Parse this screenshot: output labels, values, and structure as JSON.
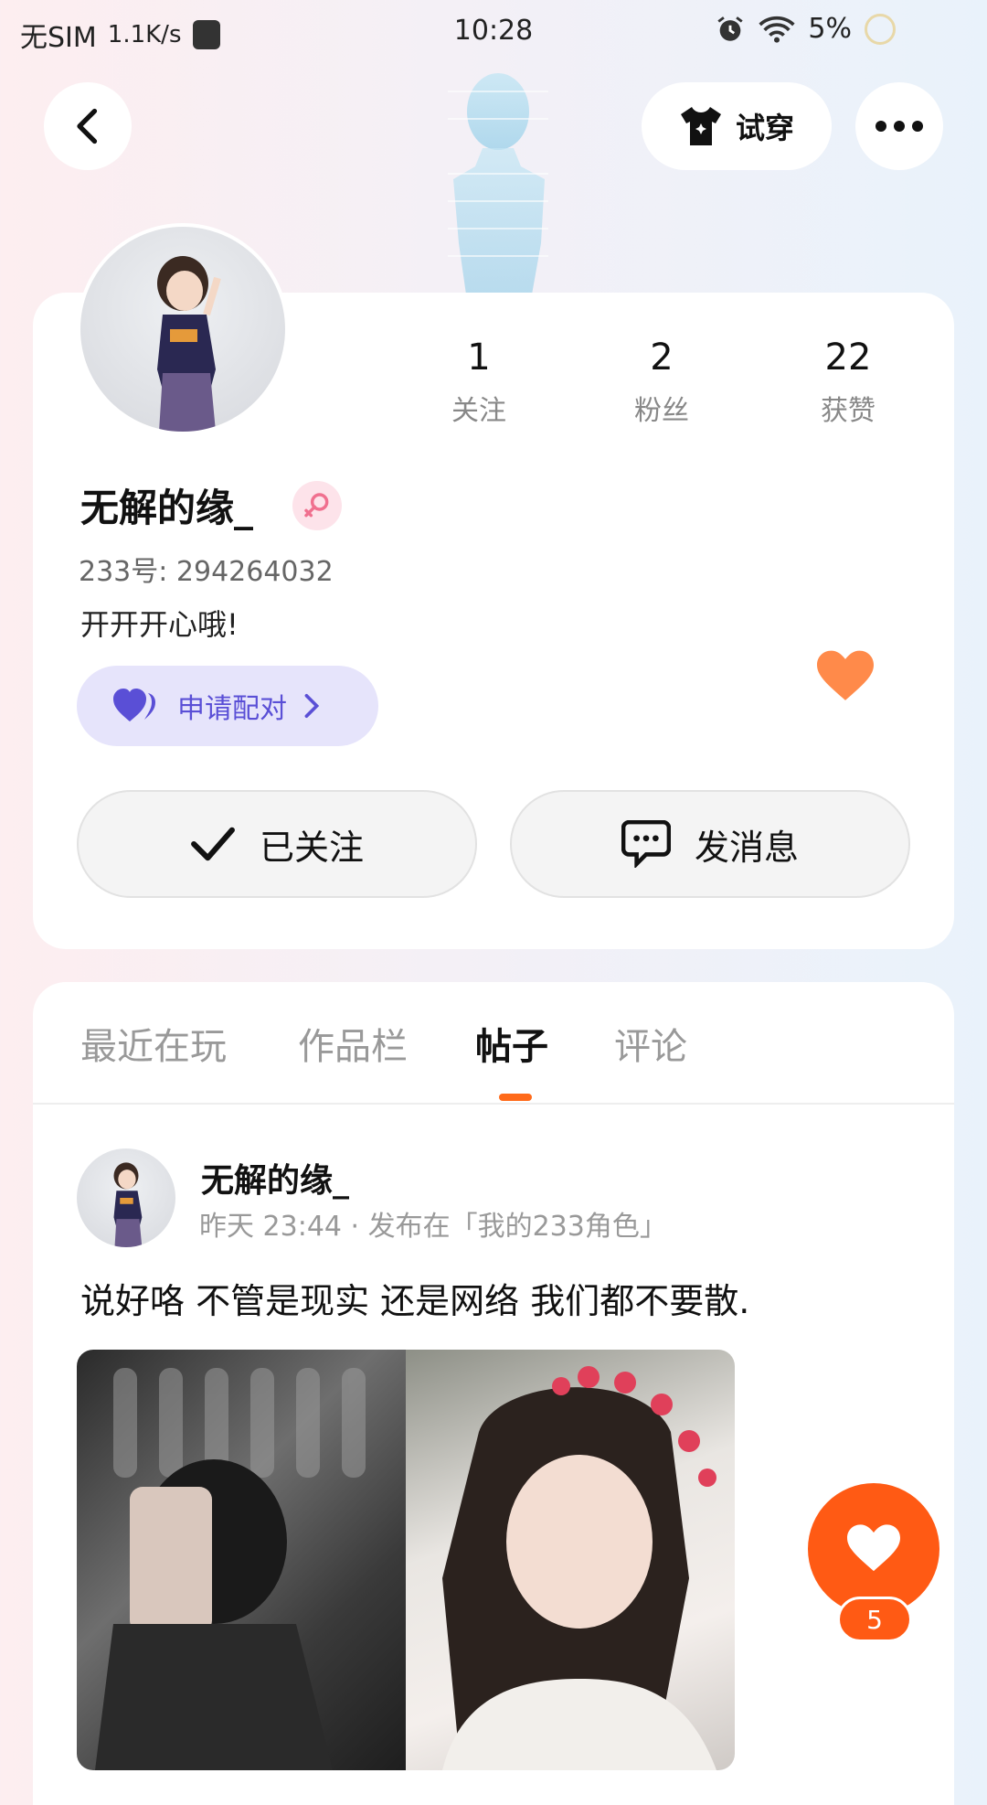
{
  "status_bar": {
    "carrier": "无SIM",
    "speed": "1.1K/s",
    "time": "10:28",
    "battery": "5%"
  },
  "toolbar": {
    "back_icon": "chevron-left-icon",
    "tryon_label": "试穿",
    "more_icon": "more-horizontal-icon"
  },
  "profile": {
    "stats": [
      {
        "num": "1",
        "label": "关注"
      },
      {
        "num": "2",
        "label": "粉丝"
      },
      {
        "num": "22",
        "label": "获赞"
      }
    ],
    "name": "无解的缘_",
    "gender_icon": "female-icon",
    "uid": "233号: 294264032",
    "bio": "开开开心哦!",
    "pair_label": "申请配对",
    "follow_label": "已关注",
    "message_label": "发消息"
  },
  "tabs": [
    {
      "label": "最近在玩"
    },
    {
      "label": "作品栏"
    },
    {
      "label": "帖子"
    },
    {
      "label": "评论"
    }
  ],
  "active_tab": "帖子",
  "post": {
    "author": "无解的缘_",
    "meta": "昨天 23:44 · 发布在「我的233角色」",
    "text": "说好咯 不管是现实 还是网络 我们都不要散.",
    "like_count": "5"
  },
  "colors": {
    "accent": "#ff5a14",
    "pair_bg": "#e6e4fb",
    "pair_text": "#5a4fd6",
    "heart": "#ff8a4a"
  }
}
